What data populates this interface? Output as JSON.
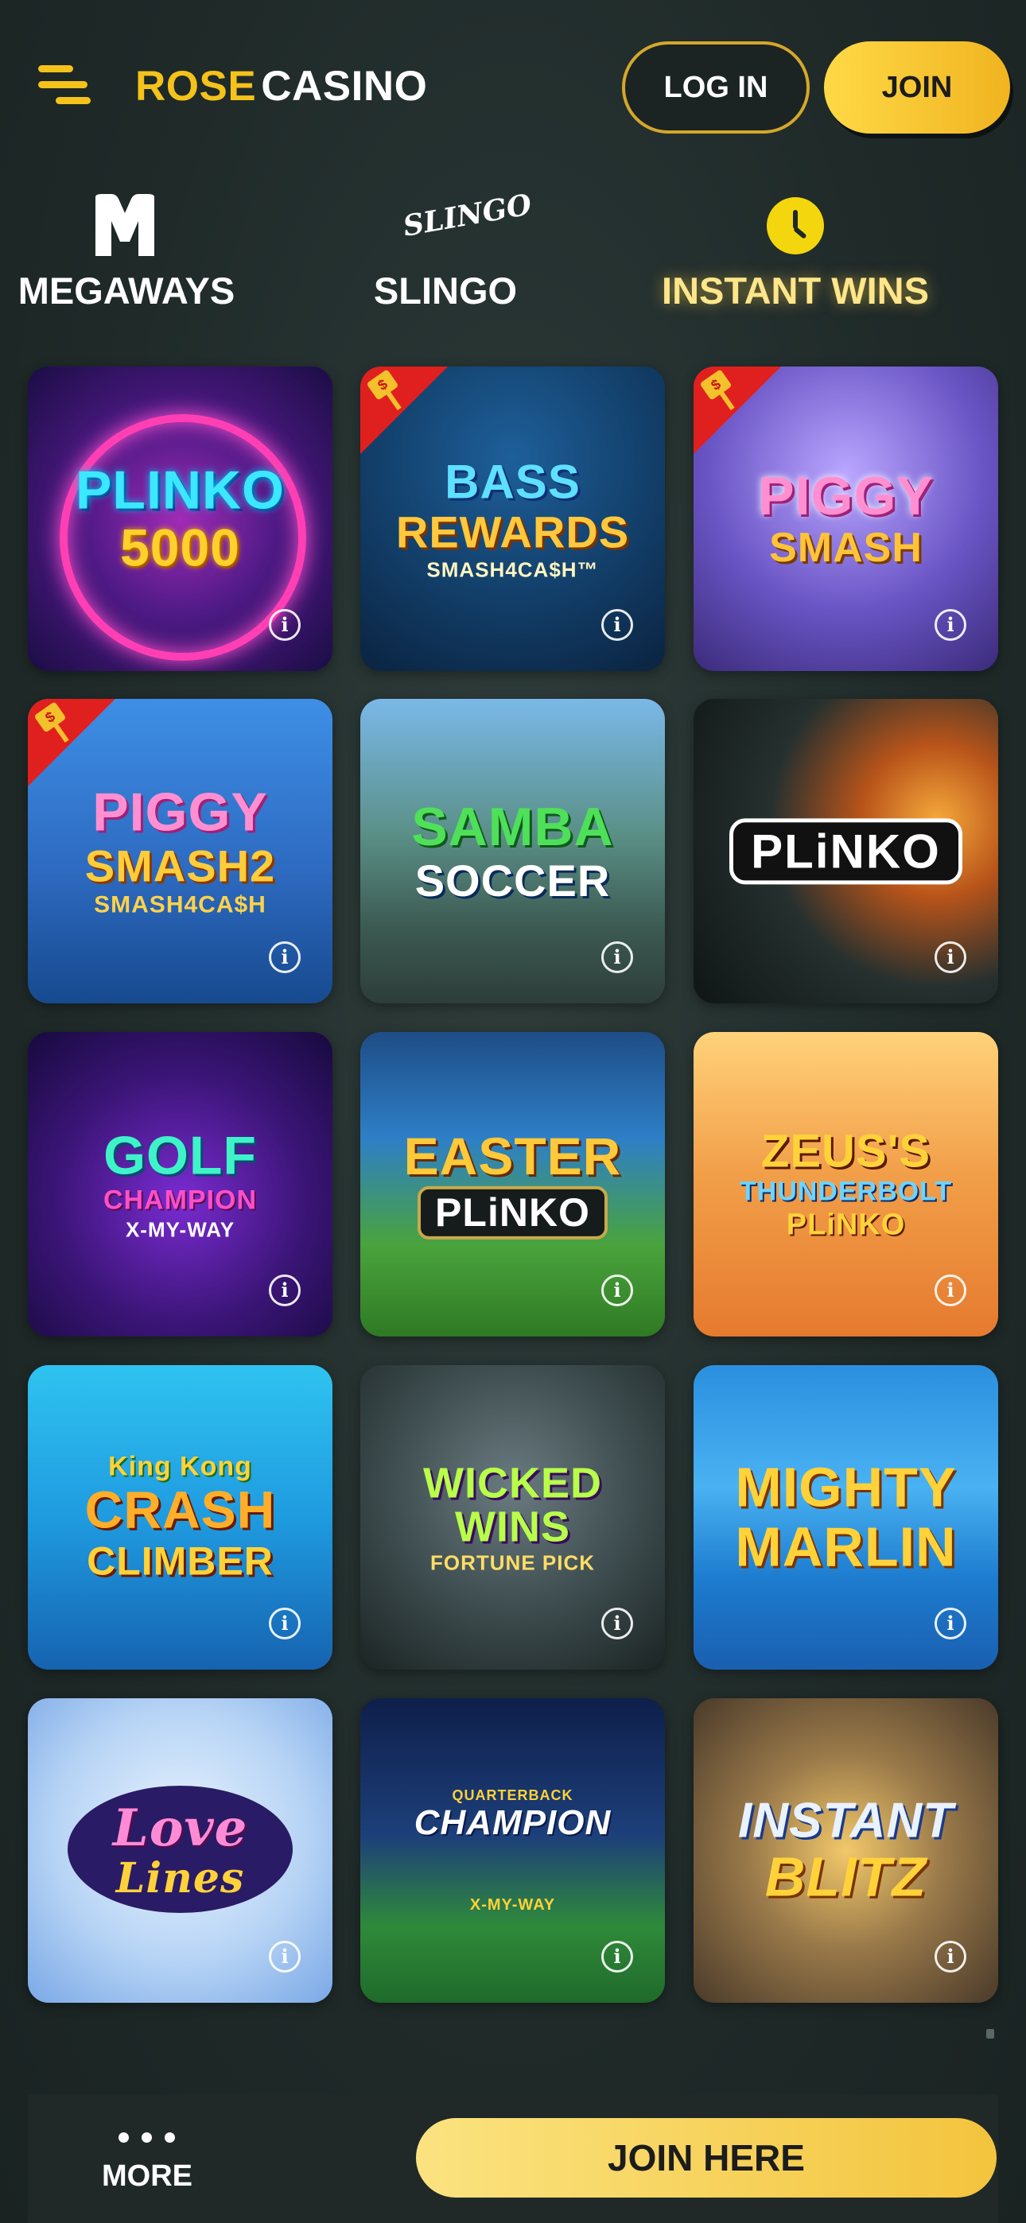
{
  "header": {
    "logo_rose": "ROSE",
    "logo_casino": "CASINO",
    "login_label": "LOG IN",
    "join_label": "JOIN"
  },
  "categories": [
    {
      "label": "MEGAWAYS",
      "icon": "megaways-m-icon"
    },
    {
      "label": "SLINGO",
      "icon_text": "SLINGO",
      "icon": "slingo-logo-icon"
    },
    {
      "label": "INSTANT WINS",
      "icon": "clock-icon",
      "active": true
    }
  ],
  "games": [
    {
      "line1": "PLINKO",
      "line2": "5000",
      "line3": ""
    },
    {
      "line1": "BASS",
      "line2": "REWARDS",
      "line3": "SMASH4CA$H™"
    },
    {
      "line1": "PIGGY",
      "line2": "SMASH",
      "line3": ""
    },
    {
      "line1": "PIGGY",
      "line2": "SMASH2",
      "line3": "SMASH4CA$H"
    },
    {
      "line1": "SAMBA",
      "line2": "SOCCER",
      "line3": ""
    },
    {
      "line1": "PLiNKO",
      "line2": "",
      "line3": ""
    },
    {
      "line1": "GOLF",
      "line2": "CHAMPION",
      "line3": "X-MY-WAY"
    },
    {
      "line1": "EASTER",
      "line2": "PLiNKO",
      "line3": ""
    },
    {
      "line1": "ZEUS'S",
      "line2": "THUNDERBOLT",
      "line3": "PLiNKO"
    },
    {
      "line1": "King Kong",
      "line2": "CRASH",
      "line3": "CLIMBER"
    },
    {
      "line1": "WICKED WINS",
      "line2": "FORTUNE PICK",
      "line3": ""
    },
    {
      "line1": "MIGHTY",
      "line2": "MARLIN",
      "line3": ""
    },
    {
      "line1": "Love",
      "line2": "Lines",
      "line3": ""
    },
    {
      "line1": "QUARTERBACK",
      "line2": "CHAMPION",
      "line3": "X-MY-WAY"
    },
    {
      "line1": "INSTANT",
      "line2": "BLITZ",
      "line3": ""
    }
  ],
  "info_icon_glyph": "i",
  "bottom_bar": {
    "more_label": "MORE",
    "join_here_label": "JOIN HERE"
  },
  "colors": {
    "accent_gold": "#f4c21b",
    "background": "#1f2a29",
    "ribbon_red": "#e0201f"
  }
}
